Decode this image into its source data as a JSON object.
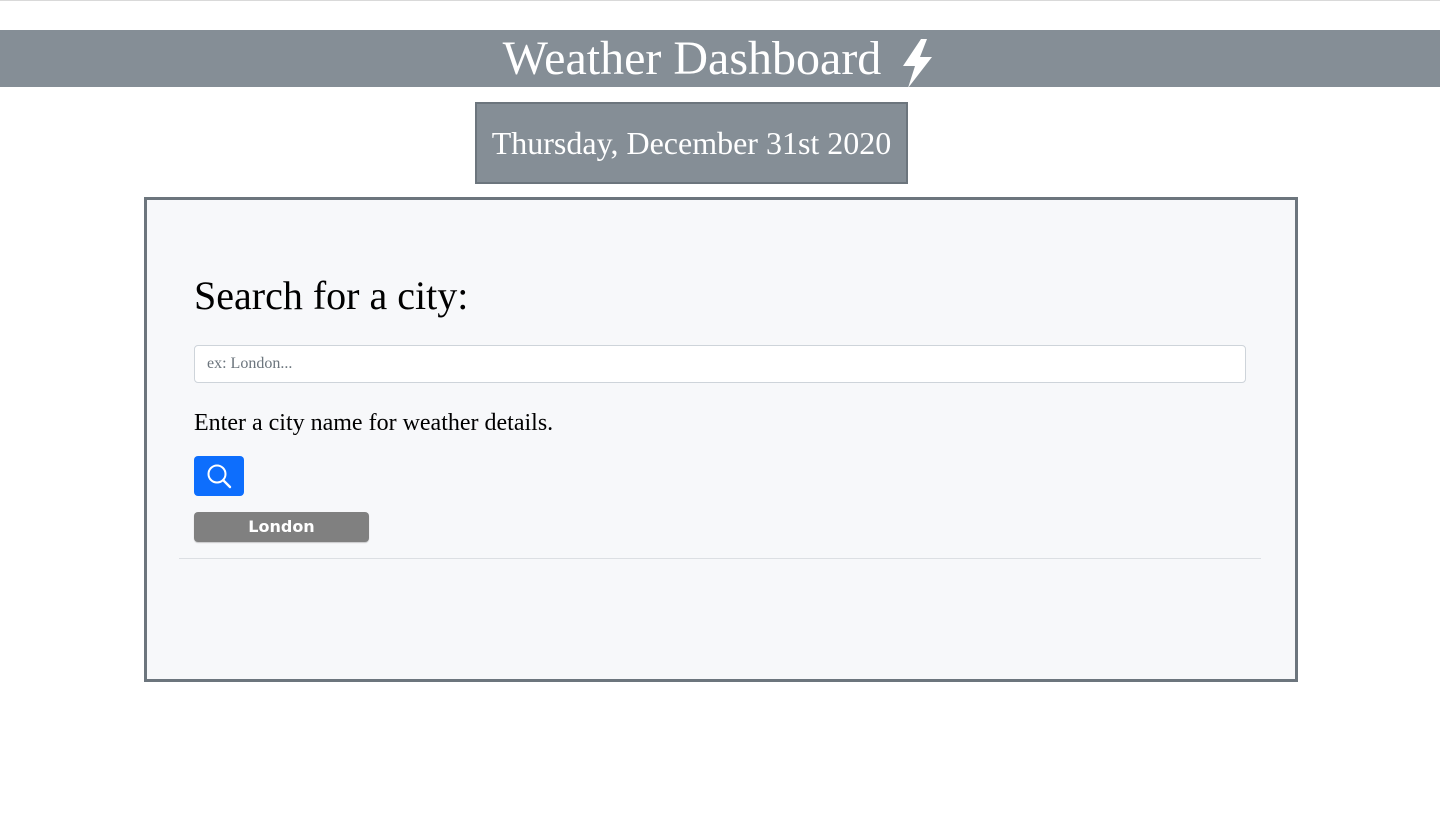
{
  "header": {
    "title": "Weather Dashboard",
    "icon": "lightning-bolt-icon"
  },
  "date": {
    "text": "Thursday, December 31st 2020"
  },
  "search": {
    "heading": "Search for a city:",
    "input_value": "",
    "placeholder": "ex: London...",
    "help_text": "Enter a city name for weather details.",
    "button_icon": "search-icon"
  },
  "history": {
    "items": [
      {
        "label": "London"
      }
    ]
  },
  "colors": {
    "header_bg": "#858e96",
    "panel_border": "#6c757d",
    "panel_bg": "#f7f8fa",
    "search_button": "#0d6efd",
    "history_button": "#808080"
  }
}
